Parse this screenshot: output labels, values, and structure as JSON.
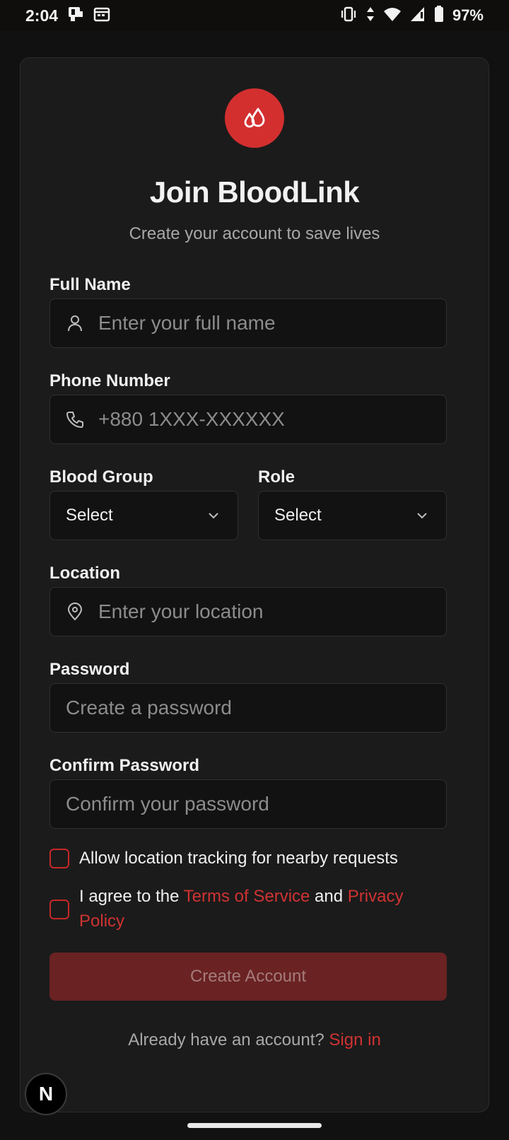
{
  "status_bar": {
    "time": "2:04",
    "battery": "97%",
    "icons": [
      "notification-icon",
      "calendar-icon",
      "vibrate-icon",
      "data-arrows-icon",
      "wifi-icon",
      "signal-icon",
      "battery-icon"
    ]
  },
  "brand": {
    "logo_icon": "blood-drops-icon",
    "accent": "#d32f2f",
    "title": "Join BloodLink",
    "subtitle": "Create your account to save lives"
  },
  "form": {
    "full_name": {
      "label": "Full Name",
      "placeholder": "Enter your full name",
      "icon": "user-icon"
    },
    "phone": {
      "label": "Phone Number",
      "placeholder": "+880 1XXX-XXXXXX",
      "icon": "phone-icon"
    },
    "blood_group": {
      "label": "Blood Group",
      "value": "Select"
    },
    "role": {
      "label": "Role",
      "value": "Select"
    },
    "location": {
      "label": "Location",
      "placeholder": "Enter your location",
      "icon": "map-pin-icon"
    },
    "password": {
      "label": "Password",
      "placeholder": "Create a password"
    },
    "confirm_password": {
      "label": "Confirm Password",
      "placeholder": "Confirm your password"
    },
    "tracking_checkbox": {
      "label": "Allow location tracking for nearby requests"
    },
    "agree_checkbox": {
      "prefix": "I agree to the ",
      "terms": "Terms of Service",
      "middle": " and ",
      "privacy": "Privacy Policy"
    },
    "submit_label": "Create Account"
  },
  "footer": {
    "prompt": "Already have an account? ",
    "signin": "Sign in"
  },
  "dev_badge": "N"
}
